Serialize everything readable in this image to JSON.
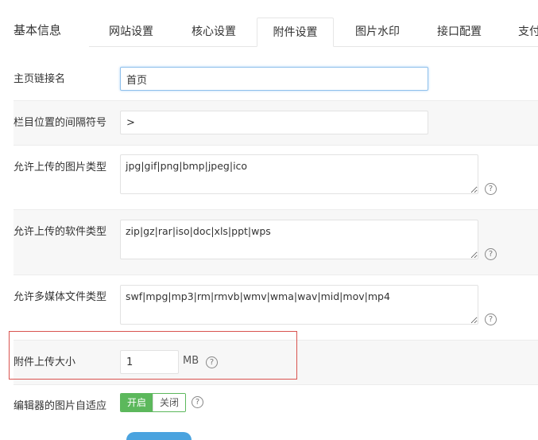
{
  "panel": {
    "title": "基本信息"
  },
  "tabs": [
    {
      "label": "网站设置"
    },
    {
      "label": "核心设置"
    },
    {
      "label": "附件设置"
    },
    {
      "label": "图片水印"
    },
    {
      "label": "接口配置"
    },
    {
      "label": "支付"
    }
  ],
  "fields": {
    "home_link_name": {
      "label": "主页链接名",
      "value": "首页"
    },
    "column_separator": {
      "label": "栏目位置的间隔符号",
      "value": ">"
    },
    "image_types": {
      "label": "允许上传的图片类型",
      "value": "jpg|gif|png|bmp|jpeg|ico"
    },
    "software_types": {
      "label": "允许上传的软件类型",
      "value": "zip|gz|rar|iso|doc|xls|ppt|wps"
    },
    "media_types": {
      "label": "允许多媒体文件类型",
      "value": "swf|mpg|mp3|rm|rmvb|wmv|wma|wav|mid|mov|mp4"
    },
    "upload_size": {
      "label": "附件上传大小",
      "value": "1",
      "unit": "MB"
    },
    "editor_image_fit": {
      "label": "编辑器的图片自适应",
      "on_label": "开启",
      "off_label": "关闭",
      "selected": "开启"
    }
  },
  "help_glyph": "?",
  "colors": {
    "accent_green": "#5cb85c",
    "highlight_red": "#d9534f",
    "focus_blue": "#8fc0ec"
  }
}
